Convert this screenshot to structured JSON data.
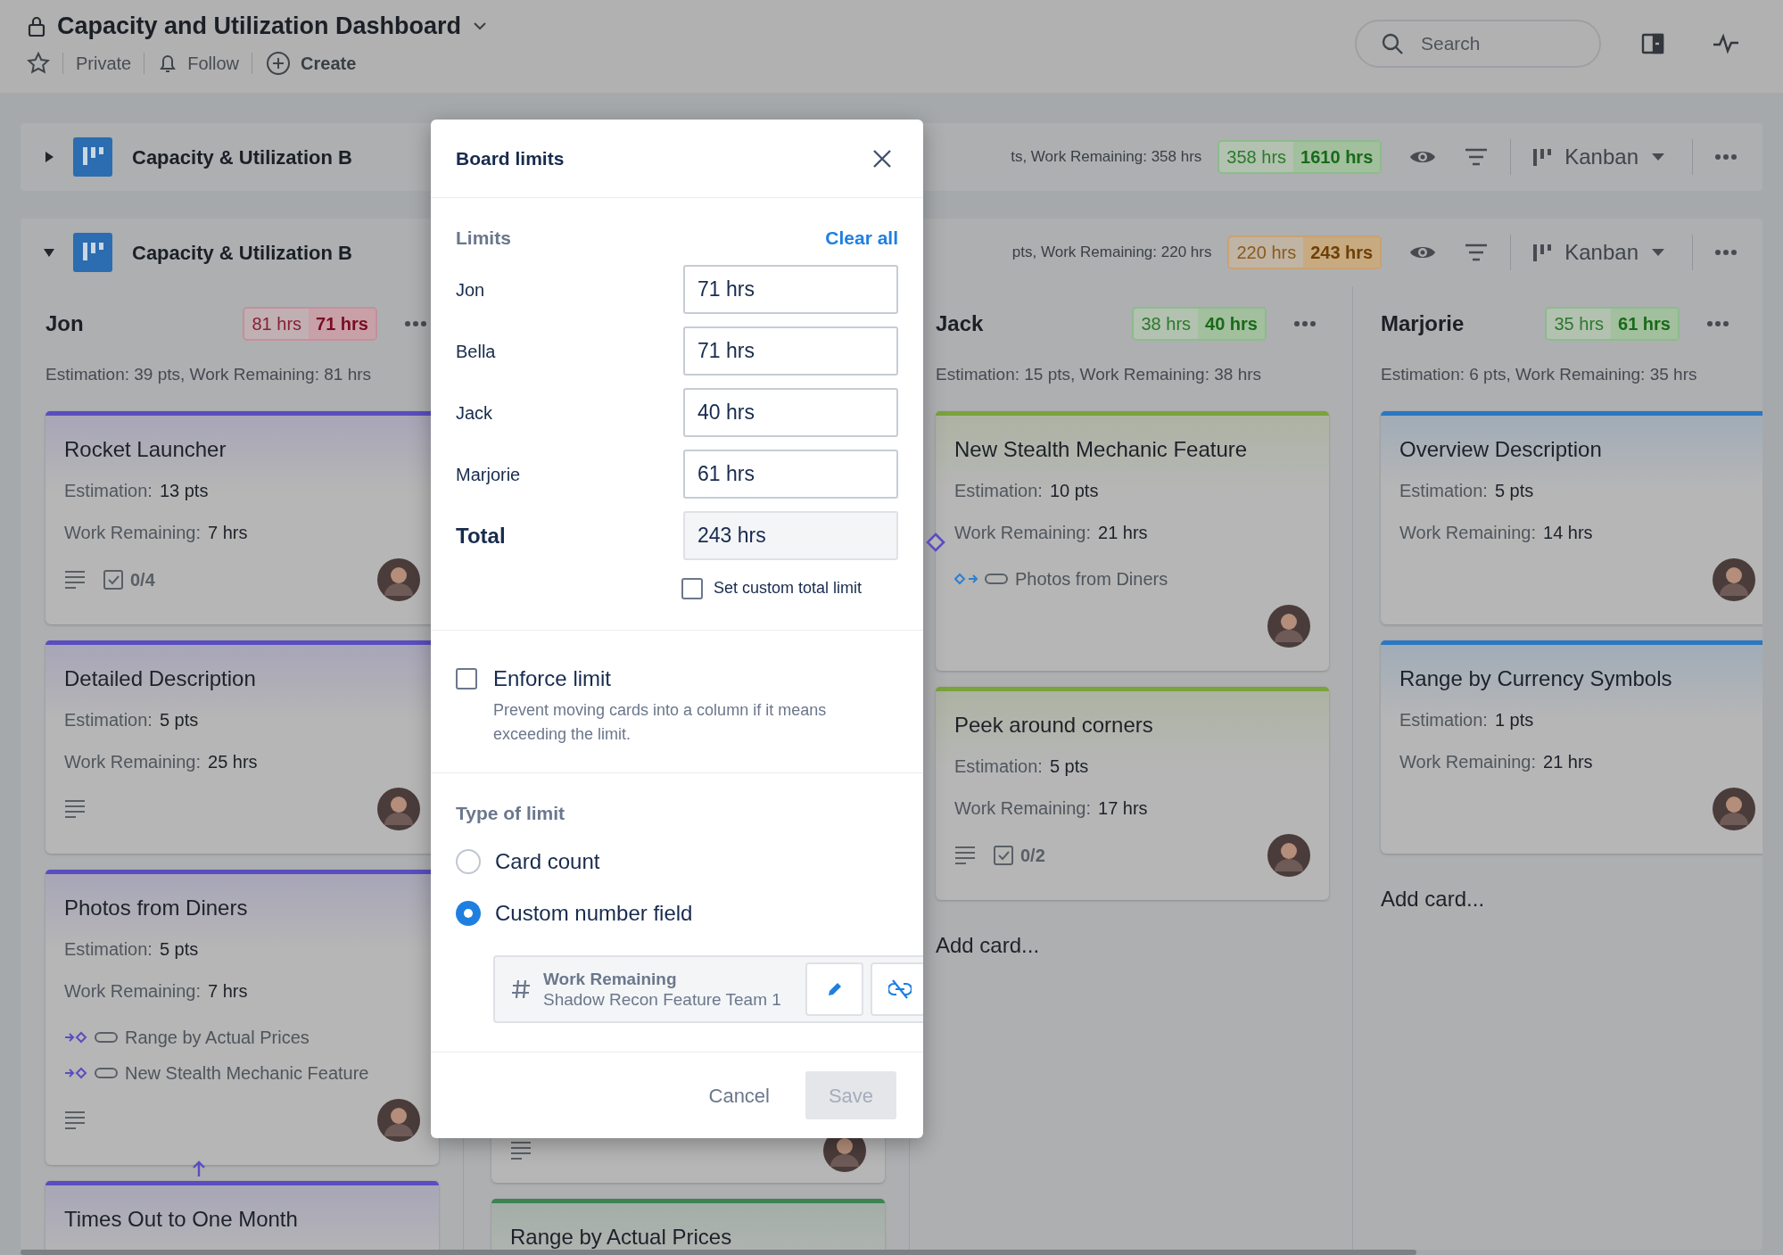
{
  "page": {
    "title": "Capacity and Utilization Dashboard",
    "starred": false,
    "visibility": "Private",
    "follow_label": "Follow",
    "create_label": "Create",
    "search": {
      "placeholder": "Search"
    }
  },
  "swimlanes": [
    {
      "title": "Capacity & Utilization B",
      "expanded": false,
      "summary": "ts, Work Remaining: 358 hrs",
      "total": "358 hrs",
      "limit": "1610 hrs",
      "over_limit": false,
      "near_limit": false,
      "view": "Kanban"
    },
    {
      "title": "Capacity & Utilization B",
      "expanded": true,
      "summary": "pts, Work Remaining: 220 hrs",
      "total": "220 hrs",
      "limit": "243 hrs",
      "over_limit": false,
      "near_limit": true,
      "view": "Kanban",
      "columns": [
        {
          "name": "Jon",
          "total": "81 hrs",
          "limit": "71 hrs",
          "over_limit": true,
          "summary": "Estimation: 39 pts, Work Remaining: 81 hrs",
          "cards": [
            {
              "title": "Rocket Launcher",
              "color": "#5a4dc0",
              "fields": [
                {
                  "label": "Estimation:",
                  "value": "13 pts"
                },
                {
                  "label": "Work Remaining:",
                  "value": "7 hrs"
                }
              ],
              "description": true,
              "checklist": "0/4",
              "assignee": true
            },
            {
              "title": "Detailed Description",
              "color": "#5a4dc0",
              "fields": [
                {
                  "label": "Estimation:",
                  "value": "5 pts"
                },
                {
                  "label": "Work Remaining:",
                  "value": "25 hrs"
                }
              ],
              "description": true,
              "assignee": true
            },
            {
              "title": "Photos from Diners",
              "color": "#5a4dc0",
              "fields": [
                {
                  "label": "Estimation:",
                  "value": "5 pts"
                },
                {
                  "label": "Work Remaining:",
                  "value": "7 hrs"
                }
              ],
              "links": [
                {
                  "incoming": true,
                  "title": "Range by Actual Prices"
                },
                {
                  "incoming": true,
                  "title": "New Stealth Mechanic Feature"
                }
              ],
              "description": true,
              "assignee": true
            },
            {
              "title": "Times Out to One Month",
              "color": "#5a4dc0",
              "incoming_arrow": true
            }
          ]
        },
        {
          "cards": [
            {
              "description": true,
              "assignee": true
            },
            {
              "title": "Range by Actual Prices",
              "color": "#3d8452"
            }
          ]
        },
        {
          "name": "Jack",
          "total": "38 hrs",
          "limit": "40 hrs",
          "over_limit": false,
          "near_limit": false,
          "summary": "Estimation: 15 pts, Work Remaining: 38 hrs",
          "add_card": "Add card...",
          "cards": [
            {
              "title": "New Stealth Mechanic Feature",
              "color": "#79a33b",
              "fields": [
                {
                  "label": "Estimation:",
                  "value": "10 pts"
                },
                {
                  "label": "Work Remaining:",
                  "value": "21 hrs"
                }
              ],
              "links": [
                {
                  "incoming": false,
                  "title": "Photos from Diners"
                }
              ],
              "assignee": true,
              "handle": true
            },
            {
              "title": "Peek around corners",
              "color": "#79a33b",
              "fields": [
                {
                  "label": "Estimation:",
                  "value": "5 pts"
                },
                {
                  "label": "Work Remaining:",
                  "value": "17 hrs"
                }
              ],
              "description": true,
              "checklist": "0/2",
              "assignee": true
            }
          ]
        },
        {
          "name": "Marjorie",
          "total": "35 hrs",
          "limit": "61 hrs",
          "over_limit": false,
          "near_limit": false,
          "summary": "Estimation: 6 pts, Work Remaining: 35 hrs",
          "add_card": "Add card...",
          "cards": [
            {
              "title": "Overview Description",
              "color": "#2b77c2",
              "fields": [
                {
                  "label": "Estimation:",
                  "value": "5 pts"
                },
                {
                  "label": "Work Remaining:",
                  "value": "14 hrs"
                }
              ],
              "assignee": true
            },
            {
              "title": "Range by Currency Symbols",
              "color": "#2b77c2",
              "fields": [
                {
                  "label": "Estimation:",
                  "value": "1 pts"
                },
                {
                  "label": "Work Remaining:",
                  "value": "21 hrs"
                }
              ],
              "assignee": true
            }
          ]
        }
      ]
    }
  ],
  "dialog": {
    "title": "Board limits",
    "section_label": "Limits",
    "clear_label": "Clear all",
    "limits": [
      {
        "name": "Jon",
        "value": "71 hrs"
      },
      {
        "name": "Bella",
        "value": "71 hrs"
      },
      {
        "name": "Jack",
        "value": "40 hrs"
      },
      {
        "name": "Marjorie",
        "value": "61 hrs"
      }
    ],
    "total": {
      "label": "Total",
      "value": "243 hrs"
    },
    "custom_total": {
      "label": "Set custom total limit",
      "checked": false
    },
    "enforce": {
      "label": "Enforce limit",
      "checked": false,
      "description": "Prevent moving cards into a column if it means exceeding the limit."
    },
    "type_label": "Type of limit",
    "types": [
      {
        "label": "Card count",
        "selected": false
      },
      {
        "label": "Custom number field",
        "selected": true
      }
    ],
    "field": {
      "name": "Work Remaining",
      "source": "Shadow Recon Feature Team 1"
    },
    "buttons": [
      {
        "label": "Cancel",
        "kind": "secondary",
        "disabled": false
      },
      {
        "label": "Save",
        "kind": "primary",
        "disabled": true
      }
    ]
  }
}
